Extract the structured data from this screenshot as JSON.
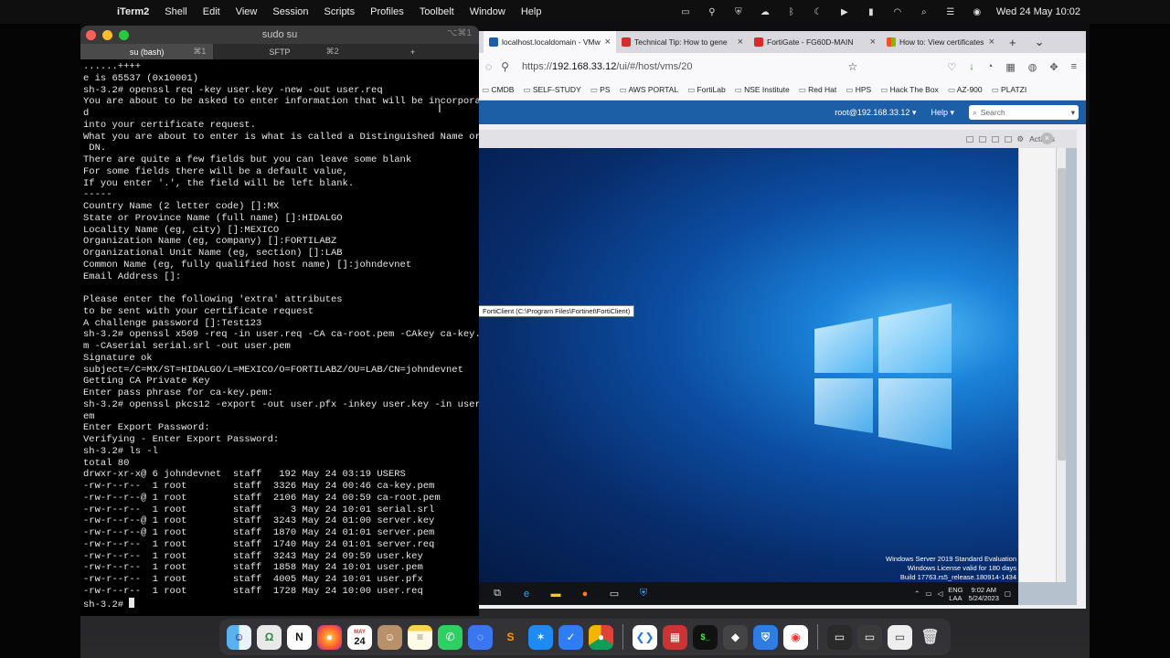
{
  "menubar": {
    "app": "iTerm2",
    "items": [
      "Shell",
      "Edit",
      "View",
      "Session",
      "Scripts",
      "Profiles",
      "Toolbelt",
      "Window",
      "Help"
    ],
    "clock": "Wed 24 May  10:02"
  },
  "terminal": {
    "title": "sudo su",
    "title_shortcut": "⌥⌘1",
    "tabs": [
      {
        "label": "su (bash)",
        "shortcut": "⌘1"
      },
      {
        "label": "SFTP",
        "shortcut": "⌘2"
      }
    ],
    "lines": [
      "......++++",
      "e is 65537 (0x10001)",
      "sh-3.2# openssl req -key user.key -new -out user.req",
      "You are about to be asked to enter information that will be incorporate",
      "d",
      "into your certificate request.",
      "What you are about to enter is what is called a Distinguished Name or a",
      " DN.",
      "There are quite a few fields but you can leave some blank",
      "For some fields there will be a default value,",
      "If you enter '.', the field will be left blank.",
      "-----",
      "Country Name (2 letter code) []:MX",
      "State or Province Name (full name) []:HIDALGO",
      "Locality Name (eg, city) []:MEXICO",
      "Organization Name (eg, company) []:FORTILABZ",
      "Organizational Unit Name (eg, section) []:LAB",
      "Common Name (eg, fully qualified host name) []:johndevnet",
      "Email Address []:",
      "",
      "Please enter the following 'extra' attributes",
      "to be sent with your certificate request",
      "A challenge password []:Test123",
      "sh-3.2# openssl x509 -req -in user.req -CA ca-root.pem -CAkey ca-key.pe",
      "m -CAserial serial.srl -out user.pem",
      "Signature ok",
      "subject=/C=MX/ST=HIDALGO/L=MEXICO/O=FORTILABZ/OU=LAB/CN=johndevnet",
      "Getting CA Private Key",
      "Enter pass phrase for ca-key.pem:",
      "sh-3.2# openssl pkcs12 -export -out user.pfx -inkey user.key -in user.p",
      "em",
      "Enter Export Password:",
      "Verifying - Enter Export Password:",
      "sh-3.2# ls -l",
      "total 80",
      "drwxr-xr-x@ 6 johndevnet  staff   192 May 24 03:19 USERS",
      "-rw-r--r--  1 root        staff  3326 May 24 00:46 ca-key.pem",
      "-rw-r--r--@ 1 root        staff  2106 May 24 00:59 ca-root.pem",
      "-rw-r--r--  1 root        staff     3 May 24 10:01 serial.srl",
      "-rw-r--r--@ 1 root        staff  3243 May 24 01:00 server.key",
      "-rw-r--r--@ 1 root        staff  1870 May 24 01:01 server.pem",
      "-rw-r--r--  1 root        staff  1740 May 24 01:01 server.req",
      "-rw-r--r--  1 root        staff  3243 May 24 09:59 user.key",
      "-rw-r--r--  1 root        staff  1858 May 24 10:01 user.pem",
      "-rw-r--r--  1 root        staff  4005 May 24 10:01 user.pfx",
      "-rw-r--r--  1 root        staff  1728 May 24 10:00 user.req"
    ],
    "prompt": "sh-3.2# "
  },
  "browser": {
    "tabs": [
      {
        "label": "localhost.localdomain - VMw",
        "color": "#1c5fa7",
        "active": true
      },
      {
        "label": "Technical Tip: How to gene",
        "color": "#d82c2c",
        "active": false
      },
      {
        "label": "FortiGate - FG60D-MAIN",
        "color": "#d82c2c",
        "active": false
      },
      {
        "label": "How to: View certificates",
        "color": "#f25022",
        "active": false
      }
    ],
    "url_prefix": "https://",
    "url_host": "192.168.33.12",
    "url_path": "/ui/#/host/vms/20",
    "bookmarks": [
      "CMDB",
      "SELF-STUDY",
      "PS",
      "AWS PORTAL",
      "FortiLab",
      "NSE Institute",
      "Red Hat",
      "HPS",
      "Hack The Box",
      "AZ-900",
      "PLATZI"
    ]
  },
  "vcenter": {
    "user": "root@192.168.33.12",
    "help": "Help",
    "search_placeholder": "Search",
    "actions": "Actions"
  },
  "vm_console": {
    "tooltip": "FortiClient (C:\\Program Files\\Fortinet\\FortiClient)",
    "watermark": [
      "Windows Server 2019 Standard Evaluation",
      "Windows License valid for 180 days",
      "Build 17763.rs5_release.180914-1434"
    ],
    "tray_lang": "ENG",
    "tray_region": "LAA",
    "tray_time": "9:02 AM",
    "tray_date": "5/24/2023"
  },
  "dock": {
    "calendar_month": "MAY",
    "calendar_day": "24"
  }
}
